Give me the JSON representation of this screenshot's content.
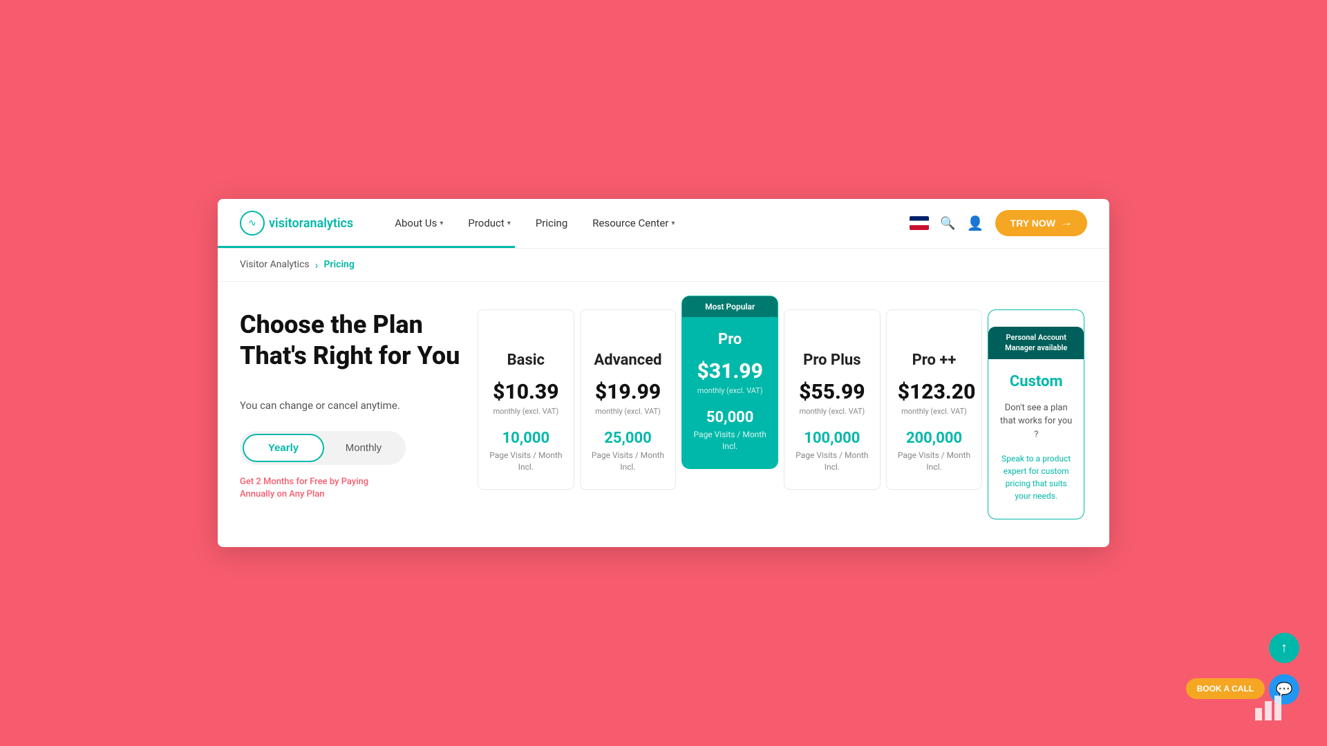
{
  "brand": {
    "name_plain": "visitor",
    "name_accent": "analytics",
    "logo_symbol": "∿"
  },
  "navbar": {
    "links": [
      {
        "id": "about-us",
        "label": "About Us",
        "has_dropdown": true
      },
      {
        "id": "product",
        "label": "Product",
        "has_dropdown": true
      },
      {
        "id": "pricing",
        "label": "Pricing",
        "has_dropdown": false
      },
      {
        "id": "resource-center",
        "label": "Resource Center",
        "has_dropdown": true
      }
    ],
    "try_now_label": "TRY NOW",
    "try_now_arrow": "→"
  },
  "breadcrumb": {
    "parent": "Visitor Analytics",
    "separator": "›",
    "current": "Pricing"
  },
  "page": {
    "title_line1": "Choose the Plan",
    "title_line2": "That's Right for You",
    "subtitle": "You can change or cancel anytime.",
    "toggle_yearly": "Yearly",
    "toggle_monthly": "Monthly",
    "promo": "Get 2 Months for Free by Paying Annually on Any Plan"
  },
  "plans": [
    {
      "id": "basic",
      "name": "Basic",
      "price": "$10.39",
      "price_note": "monthly (excl. VAT)",
      "visits": "10,000",
      "visits_label": "Page Visits / Month Incl.",
      "is_pro": false,
      "is_custom": false,
      "most_popular": false
    },
    {
      "id": "advanced",
      "name": "Advanced",
      "price": "$19.99",
      "price_note": "monthly (excl. VAT)",
      "visits": "25,000",
      "visits_label": "Page Visits / Month Incl.",
      "is_pro": false,
      "is_custom": false,
      "most_popular": false
    },
    {
      "id": "pro",
      "name": "Pro",
      "price": "$31.99",
      "price_note": "monthly (excl. VAT)",
      "visits": "50,000",
      "visits_label": "Page Visits / Month Incl.",
      "is_pro": true,
      "is_custom": false,
      "most_popular": true,
      "most_popular_label": "Most Popular"
    },
    {
      "id": "pro-plus",
      "name": "Pro Plus",
      "price": "$55.99",
      "price_note": "monthly (excl. VAT)",
      "visits": "100,000",
      "visits_label": "Page Visits / Month Incl.",
      "is_pro": false,
      "is_custom": false,
      "most_popular": false
    },
    {
      "id": "pro-pp",
      "name": "Pro ++",
      "price": "$123.20",
      "price_note": "monthly (excl. VAT)",
      "visits": "200,000",
      "visits_label": "Page Visits / Month Incl.",
      "is_pro": false,
      "is_custom": false,
      "most_popular": false
    },
    {
      "id": "custom",
      "name": "Custom",
      "personal_account_badge": "Personal Account Manager available",
      "custom_desc": "Don't see a plan that works for you ?",
      "custom_speak": "Speak to a product expert for custom pricing that suits your needs.",
      "is_pro": false,
      "is_custom": true,
      "most_popular": false
    }
  ],
  "floating": {
    "up_arrow": "↑",
    "book_a_call": "BOOK A CALL",
    "chat_icon": "💬"
  },
  "colors": {
    "teal": "#00b8a9",
    "red": "#f75c6e",
    "orange": "#f5a623",
    "blue": "#2196F3"
  }
}
